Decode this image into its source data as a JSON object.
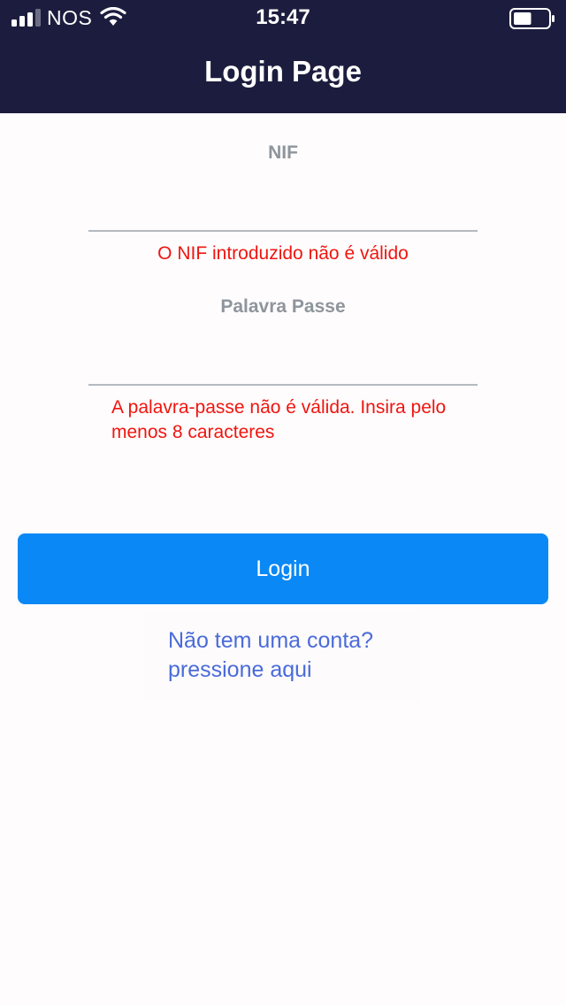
{
  "status_bar": {
    "carrier": "NOS",
    "time": "15:47",
    "battery_level": 0.5,
    "signal_icon": "signal-bars-icon",
    "wifi_icon": "wifi-icon"
  },
  "header": {
    "title": "Login Page",
    "background_color": "#1c1d3e"
  },
  "form": {
    "nif": {
      "label": "NIF",
      "value": "",
      "error": "O NIF introduzido não é válido"
    },
    "password": {
      "label": "Palavra Passe",
      "value": "",
      "error": "A palavra-passe não é válida. Insira pelo menos 8 caracteres"
    },
    "error_color": "#f0150f"
  },
  "actions": {
    "login_label": "Login",
    "login_color": "#0a88f5",
    "signup_link": "Não tem uma conta? pressione aqui",
    "link_color": "#4a6bd9"
  }
}
